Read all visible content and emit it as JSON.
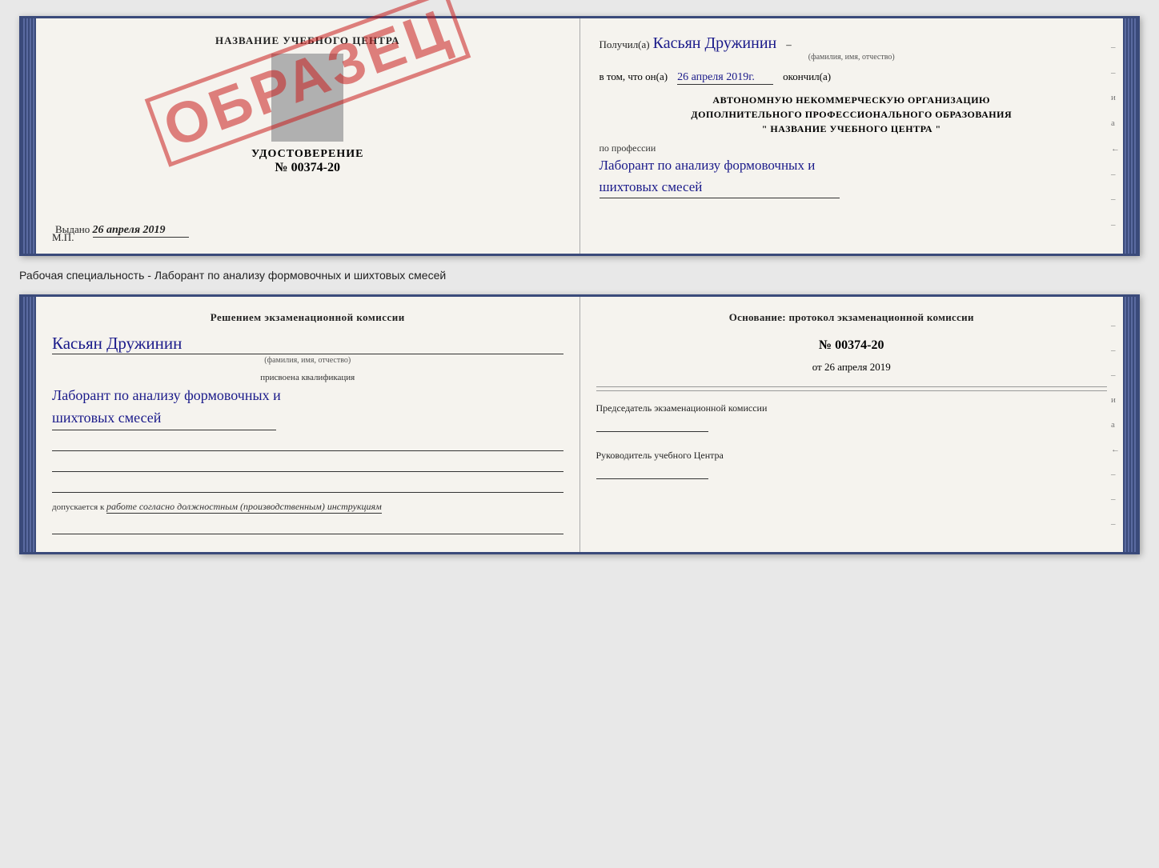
{
  "topDoc": {
    "left": {
      "title": "НАЗВАНИЕ УЧЕБНОГО ЦЕНТРА",
      "stamp": "ОБРАЗЕЦ",
      "certLabel": "УДОСТОВЕРЕНИЕ",
      "certNumber": "№ 00374-20",
      "issued": "Выдано",
      "issuedDate": "26 апреля 2019",
      "mp": "М.П."
    },
    "right": {
      "receivedLabel": "Получил(а)",
      "receivedName": "Касьян Дружинин",
      "fioLabel": "(фамилия, имя, отчество)",
      "dateLabel": "в том, что он(а)",
      "date": "26 апреля 2019г.",
      "finishedLabel": "окончил(а)",
      "orgLine1": "АВТОНОМНУЮ НЕКОММЕРЧЕСКУЮ ОРГАНИЗАЦИЮ",
      "orgLine2": "ДОПОЛНИТЕЛЬНОГО ПРОФЕССИОНАЛЬНОГО ОБРАЗОВАНИЯ",
      "orgLine3": "\"   НАЗВАНИЕ УЧЕБНОГО ЦЕНТРА   \"",
      "professionLabel": "по профессии",
      "profession1": "Лаборант по анализу формовочных и",
      "profession2": "шихтовых смесей",
      "edgeChars": [
        "–",
        "–",
        "и",
        "а",
        "←",
        "–",
        "–",
        "–"
      ]
    }
  },
  "betweenText": "Рабочая специальность - Лаборант по анализу формовочных и шихтовых смесей",
  "bottomDoc": {
    "left": {
      "commissionTitle": "Решением экзаменационной комиссии",
      "name": "Касьян Дружинин",
      "fioLabel": "(фамилия, имя, отчество)",
      "qualLabel": "присвоена квалификация",
      "qual1": "Лаборант по анализу формовочных и",
      "qual2": "шихтовых смесей",
      "allowedLabel": "допускается к",
      "allowedText": "работе согласно должностным (производственным) инструкциям"
    },
    "right": {
      "basisLabel": "Основание: протокол экзаменационной комиссии",
      "protocolNumber": "№ 00374-20",
      "datePrefix": "от",
      "date": "26 апреля 2019",
      "chairmanLabel": "Председатель экзаменационной комиссии",
      "headLabel": "Руководитель учебного Центра",
      "edgeDashes": [
        "–",
        "–",
        "–",
        "и",
        "а",
        "←",
        "–",
        "–",
        "–"
      ]
    }
  }
}
